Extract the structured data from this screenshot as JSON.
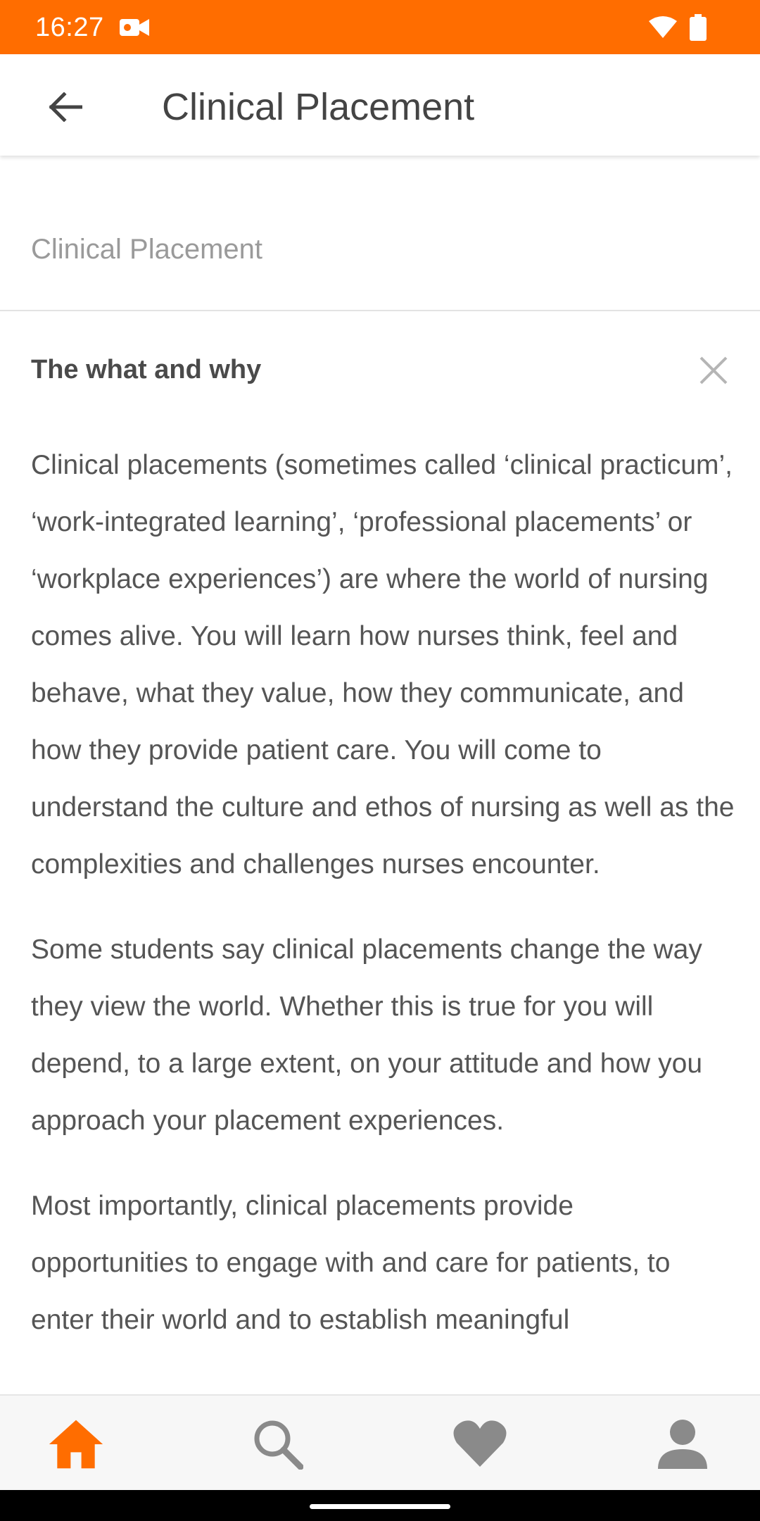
{
  "status_bar": {
    "time": "16:27",
    "icons": [
      "video-camera-icon",
      "wifi-icon",
      "battery-icon"
    ],
    "color": "#ff6d00"
  },
  "app_bar": {
    "back_icon": "arrow-back-icon",
    "title": "Clinical Placement"
  },
  "section": {
    "label": "Clinical Placement"
  },
  "card": {
    "heading": "The what and why",
    "close_icon": "close-icon",
    "paragraphs": [
      "Clinical placements (sometimes called ‘clinical practicum’, ‘work-integrated learning’, ‘professional placements’ or ‘workplace experiences’) are where the world of nursing comes alive. You will learn how nurses think, feel and behave, what they value, how they communicate, and how they provide patient care. You will come to understand the culture and ethos of nursing as well as the complexities and challenges nurses encounter.",
      "Some students say clinical placements change the way they view the world. Whether this is true for you will depend, to a large extent, on your attitude and how you approach your placement experiences.",
      "Most importantly, clinical placements provide opportunities to engage with and care for patients, to enter their world and to establish meaningful"
    ]
  },
  "bottom_nav": {
    "items": [
      {
        "icon": "home-icon",
        "active": true
      },
      {
        "icon": "search-icon",
        "active": false
      },
      {
        "icon": "heart-icon",
        "active": false
      },
      {
        "icon": "profile-icon",
        "active": false
      }
    ],
    "active_color": "#ff6d00",
    "inactive_color": "#8a8a8a"
  }
}
